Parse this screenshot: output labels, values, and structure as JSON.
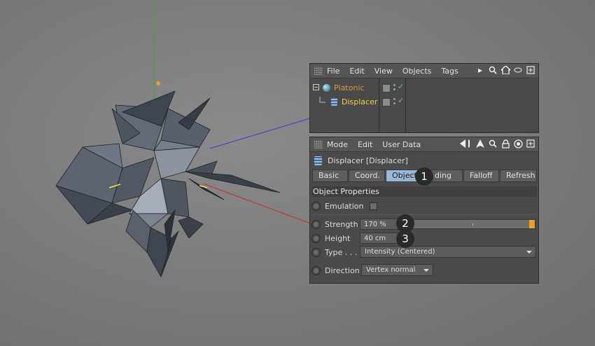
{
  "object_manager": {
    "menu": [
      "File",
      "Edit",
      "View",
      "Objects",
      "Tags"
    ],
    "objects": [
      {
        "name": "Platonic"
      },
      {
        "name": "Displacer"
      }
    ]
  },
  "attribute_manager": {
    "menu": [
      "Mode",
      "Edit",
      "User Data"
    ],
    "title": "Displacer [Displacer]",
    "tabs": [
      "Basic",
      "Coord.",
      "Object",
      "ding",
      "Falloff",
      "Refresh"
    ],
    "active_tab": "Object",
    "section": "Object Properties",
    "properties": {
      "emulation_label": "Emulation",
      "strength_label": "Strength",
      "strength_value": "170 %",
      "strength_level": 1.0,
      "height_label": "Height",
      "height_value": "40 cm",
      "type_label": "Type . . .",
      "type_value": "Intensity (Centered)",
      "direction_label": "Direction",
      "direction_value": "Vertex normal"
    }
  },
  "callouts": [
    "1",
    "2",
    "3"
  ],
  "colors": {
    "accent_orange": "#f0a020",
    "active_tab": "#9bb7d8",
    "platonic_name": "#e8923a",
    "displacer_name": "#f3d04a"
  }
}
